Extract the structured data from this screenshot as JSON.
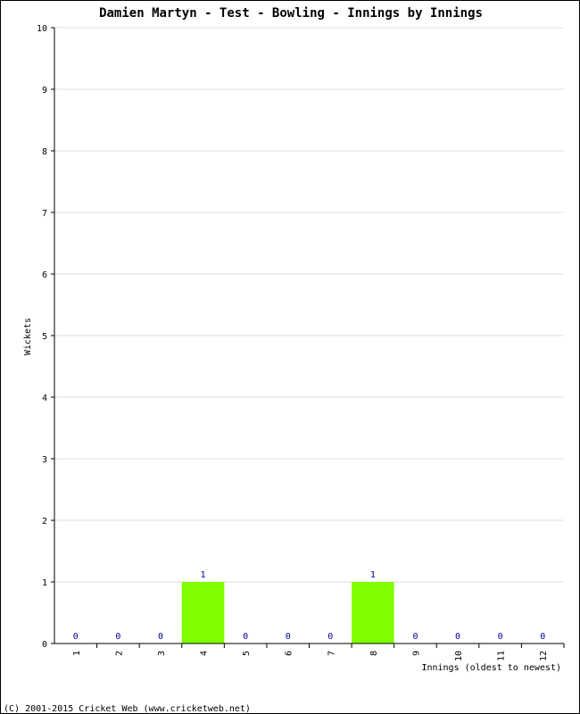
{
  "chart_data": {
    "type": "bar",
    "title": "Damien Martyn - Test - Bowling - Innings by Innings",
    "xlabel": "Innings (oldest to newest)",
    "ylabel": "Wickets",
    "categories": [
      "1",
      "2",
      "3",
      "4",
      "5",
      "6",
      "7",
      "8",
      "9",
      "10",
      "11",
      "12"
    ],
    "values": [
      0,
      0,
      0,
      1,
      0,
      0,
      0,
      1,
      0,
      0,
      0,
      0
    ],
    "ylim": [
      0,
      10
    ],
    "yticks": [
      0,
      1,
      2,
      3,
      4,
      5,
      6,
      7,
      8,
      9,
      10
    ],
    "grid": true,
    "bar_color": "#80ff00",
    "label_color": "#000099"
  },
  "footer": "(C) 2001-2015 Cricket Web (www.cricketweb.net)"
}
